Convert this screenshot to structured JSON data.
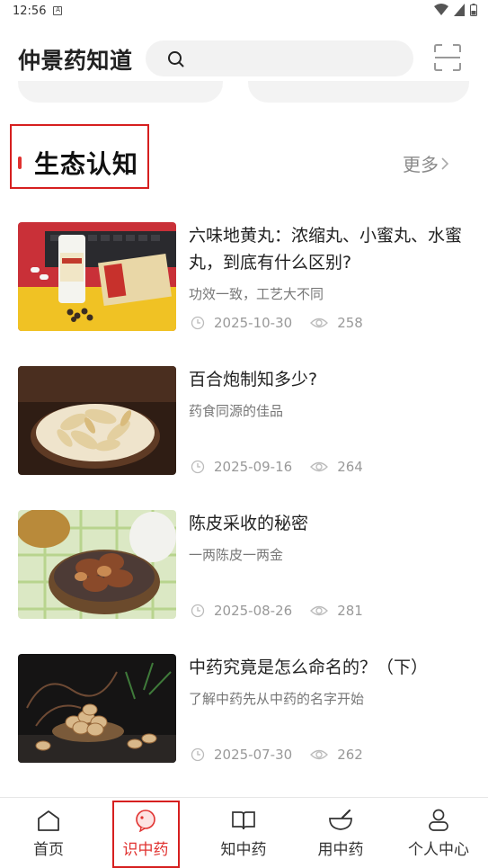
{
  "status": {
    "time": "12:56"
  },
  "header": {
    "title": "仲景药知道",
    "search_placeholder": ""
  },
  "section": {
    "title": "生态认知",
    "more_label": "更多"
  },
  "articles": [
    {
      "title": "六味地黄丸：浓缩丸、小蜜丸、水蜜丸，到底有什么区别?",
      "subtitle": "功效一致，工艺大不同",
      "date": "2025-10-30",
      "views": "258"
    },
    {
      "title": "百合炮制知多少?",
      "subtitle": "药食同源的佳品",
      "date": "2025-09-16",
      "views": "264"
    },
    {
      "title": "陈皮采收的秘密",
      "subtitle": "一两陈皮一两金",
      "date": "2025-08-26",
      "views": "281"
    },
    {
      "title": "中药究竟是怎么命名的？（下）",
      "subtitle": "了解中药先从中药的名字开始",
      "date": "2025-07-30",
      "views": "262"
    }
  ],
  "tabs": [
    {
      "label": "首页",
      "icon": "home-icon"
    },
    {
      "label": "识中药",
      "icon": "bubble-icon",
      "active": true
    },
    {
      "label": "知中药",
      "icon": "book-icon"
    },
    {
      "label": "用中药",
      "icon": "mortar-icon"
    },
    {
      "label": "个人中心",
      "icon": "person-icon"
    }
  ],
  "colors": {
    "accent": "#e0312f",
    "highlight_box": "#d61f1f",
    "muted": "#999999"
  }
}
